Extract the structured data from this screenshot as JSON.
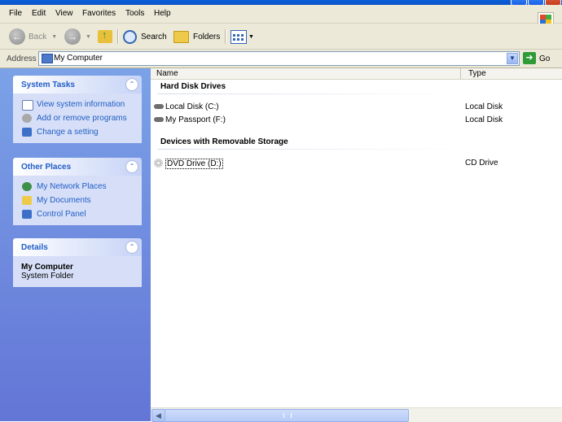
{
  "menu": [
    "File",
    "Edit",
    "View",
    "Favorites",
    "Tools",
    "Help"
  ],
  "toolbar": {
    "back": "Back",
    "search": "Search",
    "folders": "Folders"
  },
  "address": {
    "label": "Address",
    "value": "My Computer",
    "go": "Go"
  },
  "panels": {
    "system_tasks": {
      "title": "System Tasks",
      "items": [
        "View system information",
        "Add or remove programs",
        "Change a setting"
      ]
    },
    "other_places": {
      "title": "Other Places",
      "items": [
        "My Network Places",
        "My Documents",
        "Control Panel"
      ]
    },
    "details": {
      "title": "Details",
      "name": "My Computer",
      "desc": "System Folder"
    }
  },
  "columns": {
    "name": "Name",
    "type": "Type"
  },
  "groups": [
    {
      "title": "Hard Disk Drives",
      "items": [
        {
          "name": "Local Disk (C:)",
          "type": "Local Disk"
        },
        {
          "name": "My Passport (F:)",
          "type": "Local Disk"
        }
      ]
    },
    {
      "title": "Devices with Removable Storage",
      "items": [
        {
          "name": "DVD Drive (D:)",
          "type": "CD Drive"
        }
      ]
    }
  ],
  "colors": {
    "task_pane_top": "#7ba2e7",
    "task_pane_bottom": "#6375d6",
    "link": "#215dc6",
    "panel_body": "#d6dff7"
  }
}
